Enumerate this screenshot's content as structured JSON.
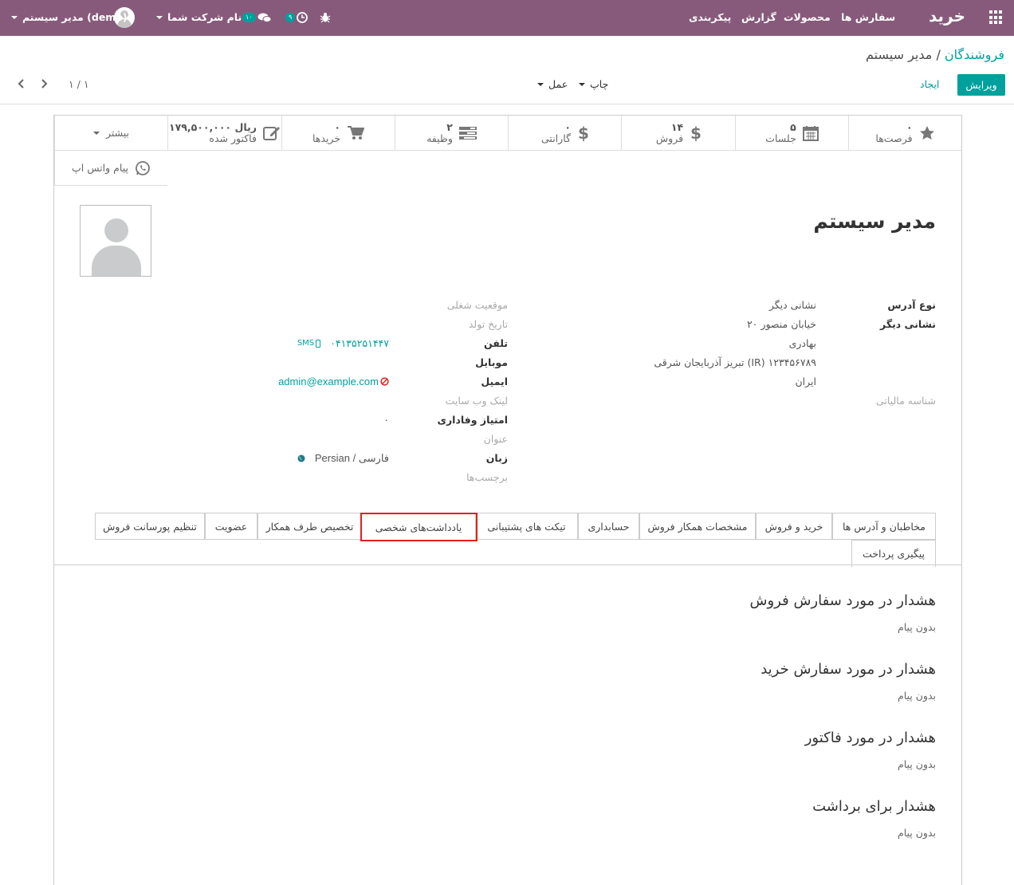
{
  "topbar": {
    "app_name": "خرید",
    "menu": [
      "سفارش ها",
      "محصولات",
      "گزارش",
      "پیکربندی"
    ],
    "activity_badge": "۹",
    "messages_badge": "۱۰",
    "company": "نام شرکت شما",
    "user": "مدیر سیستم (demo)",
    "colors": {
      "bar": "#875a7b",
      "accent": "#00a09d"
    }
  },
  "control_panel": {
    "breadcrumb_parent": "فروشندگان",
    "breadcrumb_sep": "/",
    "breadcrumb_current": "مدیر سیستم",
    "edit": "ویرایش",
    "create": "ایجاد",
    "print": "چاپ",
    "action": "عمل",
    "pager": "۱ / ۱"
  },
  "smart_buttons": [
    {
      "icon": "star-icon",
      "count": "۰",
      "label": "فرصت‌ها"
    },
    {
      "icon": "calendar-icon",
      "count": "۵",
      "label": "جلسات"
    },
    {
      "icon": "dollar-icon",
      "count": "۱۴",
      "label": "فروش"
    },
    {
      "icon": "dollar-icon",
      "count": "۰",
      "label": "گارانتی"
    },
    {
      "icon": "tasks-icon",
      "count": "۲",
      "label": "وظیفه"
    },
    {
      "icon": "cart-icon",
      "count": "۰",
      "label": "خریدها"
    },
    {
      "icon": "edit-icon",
      "count": "۱۷۹,۵۰۰,۰۰۰ ریال",
      "label": "فاکتور شده"
    },
    {
      "icon": "caret-down-icon",
      "count": "",
      "label": "بیشتر"
    }
  ],
  "whatsapp": "پیام واتس اپ",
  "partner": {
    "name": "مدیر سیستم",
    "address_type_label": "نوع آدرس",
    "address_type_value": "نشانی دیگر",
    "other_address_label": "نشانی دیگر",
    "address_lines": [
      "۲۰ خیابان منصور",
      "بهادری",
      "تبریز  آذربایجان شرقی (IR)  ۱۲۳۴۵۶۷۸۹",
      "ایران"
    ],
    "tax_id_label": "شناسه مالیاتی",
    "job_label": "موقعیت شغلی",
    "birthday_label": "تاریخ تولد",
    "phone_label": "تلفن",
    "phone_value": "۰۴۱۳۵۲۵۱۴۴۷",
    "sms": "SMS",
    "mobile_label": "موبایل",
    "email_label": "ایمیل",
    "email_value": "admin@example.com",
    "website_label": "لینک وب سایت",
    "loyalty_label": "امتیاز وفاداری",
    "loyalty_value": "۰",
    "title_label": "عنوان",
    "lang_label": "زبان",
    "lang_value": "Persian / فارسی",
    "tags_label": "برچسب‌ها"
  },
  "tabs": [
    "مخاطبان و آدرس ها",
    "خرید و فروش",
    "مشخصات همکار فروش",
    "حسابداری",
    "تیکت های پشتیبانی",
    "یادداشت‌های شخصی",
    "تخصیص طرف همکار",
    "عضویت",
    "تنظیم پورسانت فروش",
    "پیگیری پرداخت"
  ],
  "warnings": [
    {
      "title": "هشدار در مورد سفارش فروش",
      "value": "بدون پیام"
    },
    {
      "title": "هشدار در مورد سفارش خرید",
      "value": "بدون پیام"
    },
    {
      "title": "هشدار در مورد فاکتور",
      "value": "بدون پیام"
    },
    {
      "title": "هشدار برای برداشت",
      "value": "بدون پیام"
    }
  ]
}
